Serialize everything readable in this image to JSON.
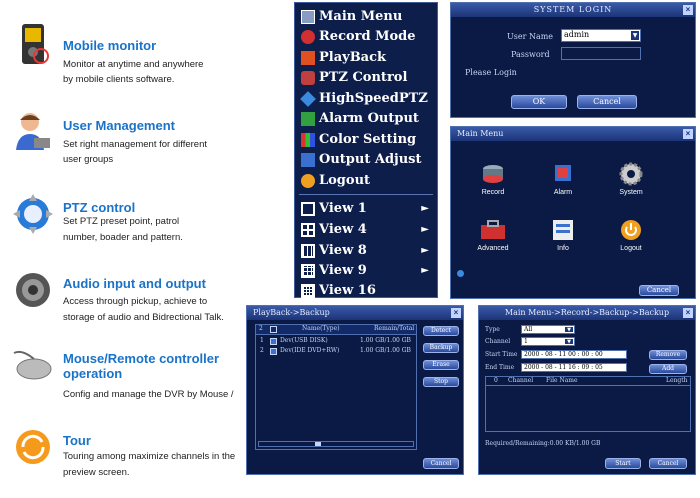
{
  "features": [
    {
      "title": "Mobile monitor",
      "lines": [
        "Monitor at anytime and anywhere",
        "by mobile clients software."
      ],
      "icon": "mobile-phone-icon"
    },
    {
      "title": "User Management",
      "lines": [
        "Set right management for different",
        "user groups"
      ],
      "icon": "user-icon"
    },
    {
      "title": "PTZ control",
      "lines": [
        "Set PTZ preset point, patrol",
        "number, boader and pattern."
      ],
      "icon": "ptz-control-icon"
    },
    {
      "title": "Audio input and output",
      "lines": [
        "Access through pickup, achieve to",
        "storage of audio and Bidrectional Talk."
      ],
      "icon": "speaker-icon"
    },
    {
      "title": "Mouse/Remote controller",
      "title2": "operation",
      "lines": [
        "Config and manage the DVR by Mouse /"
      ],
      "icon": "mouse-icon"
    },
    {
      "title": "Tour",
      "lines": [
        "Touring among maximize channels in the",
        "preview screen."
      ],
      "icon": "tour-icon"
    }
  ],
  "main_menu": {
    "items": [
      "Main Menu",
      "Record Mode",
      "PlayBack",
      "PTZ Control",
      "HighSpeedPTZ",
      "Alarm Output",
      "Color Setting",
      "Output Adjust",
      "Logout"
    ],
    "views": [
      "View 1",
      "View 4",
      "View 8",
      "View 9",
      "View 16"
    ],
    "arrow": "►"
  },
  "system_login": {
    "title": "SYSTEM LOGIN",
    "user_name_label": "User Name",
    "user_name_value": "admin",
    "password_label": "Password",
    "status": "Please Login",
    "ok": "OK",
    "cancel": "Cancel"
  },
  "main_menu_window": {
    "title": "Main Menu",
    "icons": [
      "Record",
      "Alarm",
      "System",
      "Advanced",
      "Info",
      "Logout"
    ],
    "cancel": "Cancel"
  },
  "playback_backup": {
    "title": "PlayBack->Backup",
    "headers": [
      "2",
      "Name(Type)",
      "Remain/Total"
    ],
    "rows": [
      {
        "num": "1",
        "name": "Dev(USB DISK)",
        "size": "1.00 GB/1.00 GB"
      },
      {
        "num": "2",
        "name": "Dev(IDE DVD+RW)",
        "size": "1.00 GB/1.00 GB"
      }
    ],
    "buttons": [
      "Detect",
      "Backup",
      "Erase",
      "Stop"
    ],
    "cancel": "Cancel"
  },
  "record_backup": {
    "title": "Main Menu->Record->Backup->Backup",
    "type_label": "Type",
    "type_value": "All",
    "channel_label": "Channel",
    "channel_value": "1",
    "start_label": "Start Time",
    "start_value": "2000 - 08 - 11   00 : 00 : 00",
    "end_label": "End Time",
    "end_value": "2000 - 08 - 11   16 : 09 : 05",
    "remove": "Remove",
    "add": "Add",
    "headers": [
      "0",
      "Channel",
      "File Name",
      "Length"
    ],
    "required": "Required/Remaining:0.00 KB/1.00 GB",
    "start": "Start",
    "cancel": "Cancel"
  },
  "colors": {
    "feature_title": "#1a73c8",
    "panel_bg": "#0e1e4a",
    "accent": "#3a5aa8"
  }
}
